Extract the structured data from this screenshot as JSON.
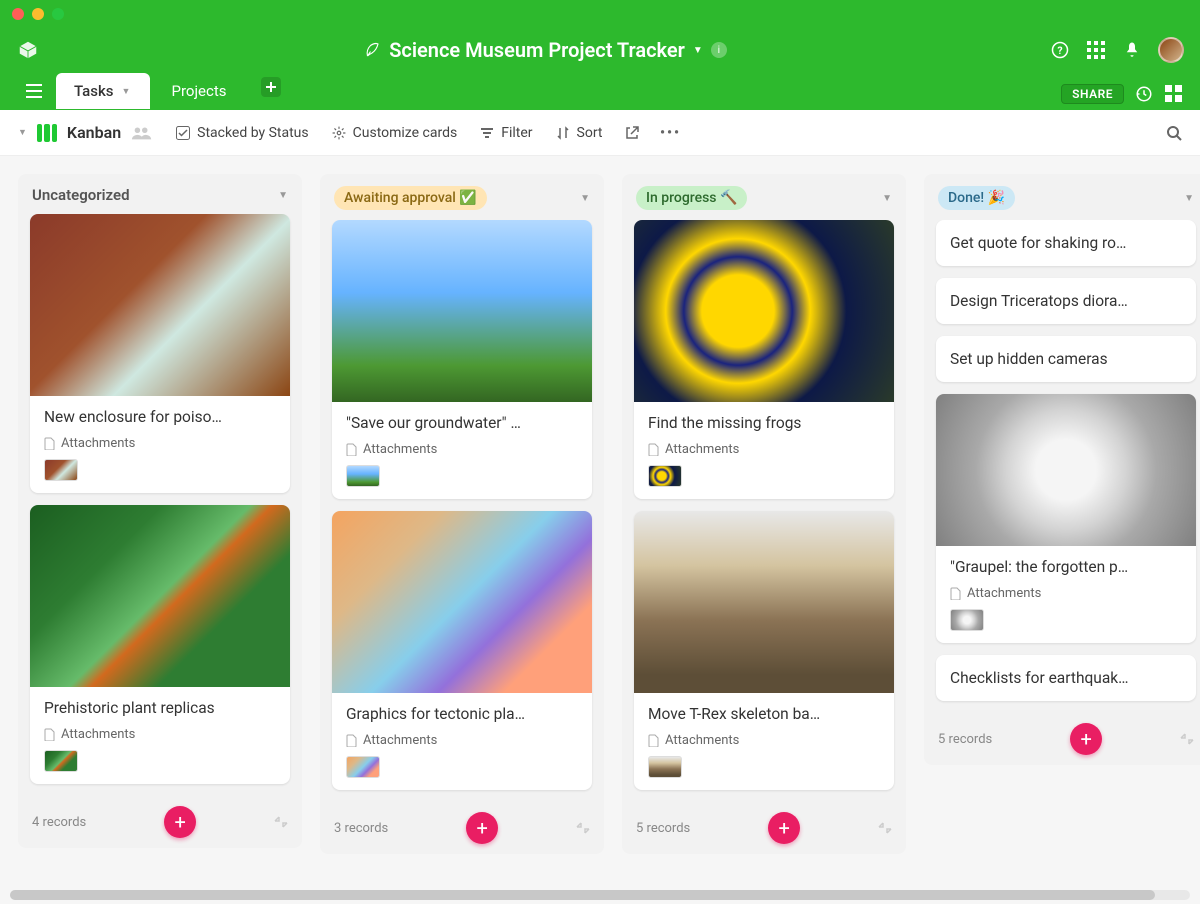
{
  "header": {
    "title": "Science Museum Project Tracker"
  },
  "tabs": {
    "active": "Tasks",
    "secondary": "Projects",
    "share_label": "SHARE"
  },
  "toolbar": {
    "view_name": "Kanban",
    "stacked_by": "Stacked by Status",
    "customize": "Customize cards",
    "filter": "Filter",
    "sort": "Sort"
  },
  "columns": [
    {
      "title": "Uncategorized",
      "pill": false,
      "pill_bg": "",
      "pill_color": "",
      "record_count": "4 records",
      "cards": [
        {
          "title": "New enclosure for poiso…",
          "attachments_label": "Attachments",
          "image_class": "img-frog-red",
          "has_image": true,
          "has_attachments": true
        },
        {
          "title": "Prehistoric plant replicas",
          "attachments_label": "Attachments",
          "image_class": "img-plant",
          "has_image": true,
          "has_attachments": true
        }
      ]
    },
    {
      "title": "Awaiting approval ✅",
      "pill": true,
      "pill_bg": "#ffe5b4",
      "pill_color": "#8b6914",
      "record_count": "3 records",
      "cards": [
        {
          "title": "\"Save our groundwater\" …",
          "attachments_label": "Attachments",
          "image_class": "img-water-cycle",
          "has_image": true,
          "has_attachments": true
        },
        {
          "title": "Graphics for tectonic pla…",
          "attachments_label": "Attachments",
          "image_class": "img-tectonic",
          "has_image": true,
          "has_attachments": true
        }
      ]
    },
    {
      "title": "In progress 🔨",
      "pill": true,
      "pill_bg": "#c8f0c8",
      "pill_color": "#2d6a2d",
      "record_count": "5 records",
      "cards": [
        {
          "title": "Find the missing frogs",
          "attachments_label": "Attachments",
          "image_class": "img-frog-yellow",
          "has_image": true,
          "has_attachments": true
        },
        {
          "title": "Move T-Rex skeleton ba…",
          "attachments_label": "Attachments",
          "image_class": "img-trex",
          "has_image": true,
          "has_attachments": true
        }
      ]
    },
    {
      "title": "Done! 🎉",
      "pill": true,
      "pill_bg": "#cce8f5",
      "pill_color": "#2b6a8a",
      "record_count": "5 records",
      "cards": [
        {
          "title": "Get quote for shaking ro…",
          "has_image": false,
          "has_attachments": false
        },
        {
          "title": "Design Triceratops diora…",
          "has_image": false,
          "has_attachments": false
        },
        {
          "title": "Set up hidden cameras",
          "has_image": false,
          "has_attachments": false
        },
        {
          "title": "\"Graupel: the forgotten p…",
          "attachments_label": "Attachments",
          "image_class": "img-graupel",
          "has_image": true,
          "has_attachments": true,
          "image_short": true
        },
        {
          "title": "Checklists for earthquak…",
          "has_image": false,
          "has_attachments": false
        }
      ]
    }
  ]
}
